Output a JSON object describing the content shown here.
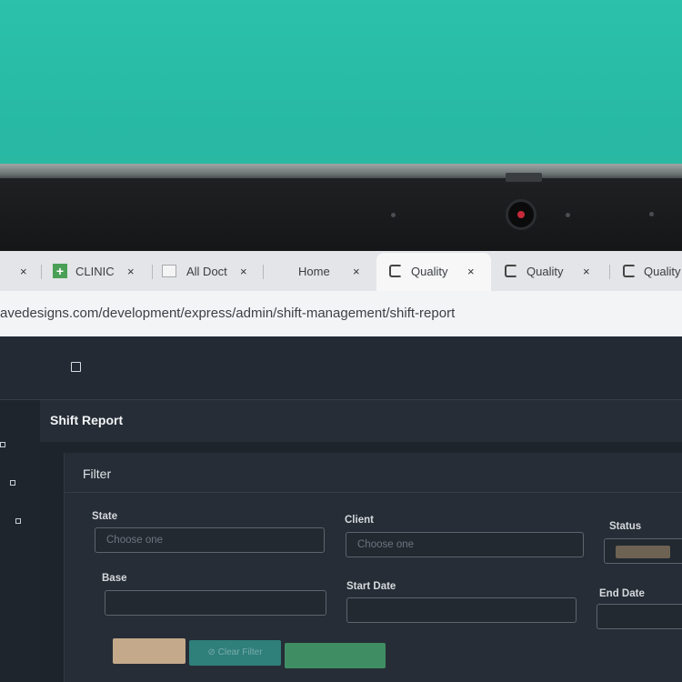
{
  "browser": {
    "tabs": [
      {
        "label": "",
        "icon": "generic-tab-icon"
      },
      {
        "label": "CLINIC",
        "icon": "plus-square-icon"
      },
      {
        "label": "All Doct",
        "icon": "document-icon"
      },
      {
        "label": "Home",
        "icon": "page-icon"
      },
      {
        "label": "Quality",
        "icon": "loop-icon"
      },
      {
        "label": "Quality",
        "icon": "loop-icon"
      },
      {
        "label": "Quality",
        "icon": "loop-icon"
      }
    ],
    "close_glyph": "×",
    "url": "avedesigns.com/development/express/admin/shift-management/shift-report"
  },
  "app": {
    "page_title": "Shift Report",
    "filter": {
      "title": "Filter",
      "fields": {
        "state": {
          "label": "State",
          "placeholder": "Choose one"
        },
        "client": {
          "label": "Client",
          "placeholder": "Choose one"
        },
        "status": {
          "label": "Status"
        },
        "base": {
          "label": "Base"
        },
        "start_date": {
          "label": "Start Date"
        },
        "end_date": {
          "label": "End Date"
        }
      },
      "buttons": {
        "clear_filter": "Clear Filter"
      }
    }
  },
  "colors": {
    "wall": "#2ab8a3",
    "app_background": "#1e242c",
    "button_search": "#c4a98a",
    "button_clear": "#2f7f7b",
    "button_export": "#3f8e63"
  }
}
